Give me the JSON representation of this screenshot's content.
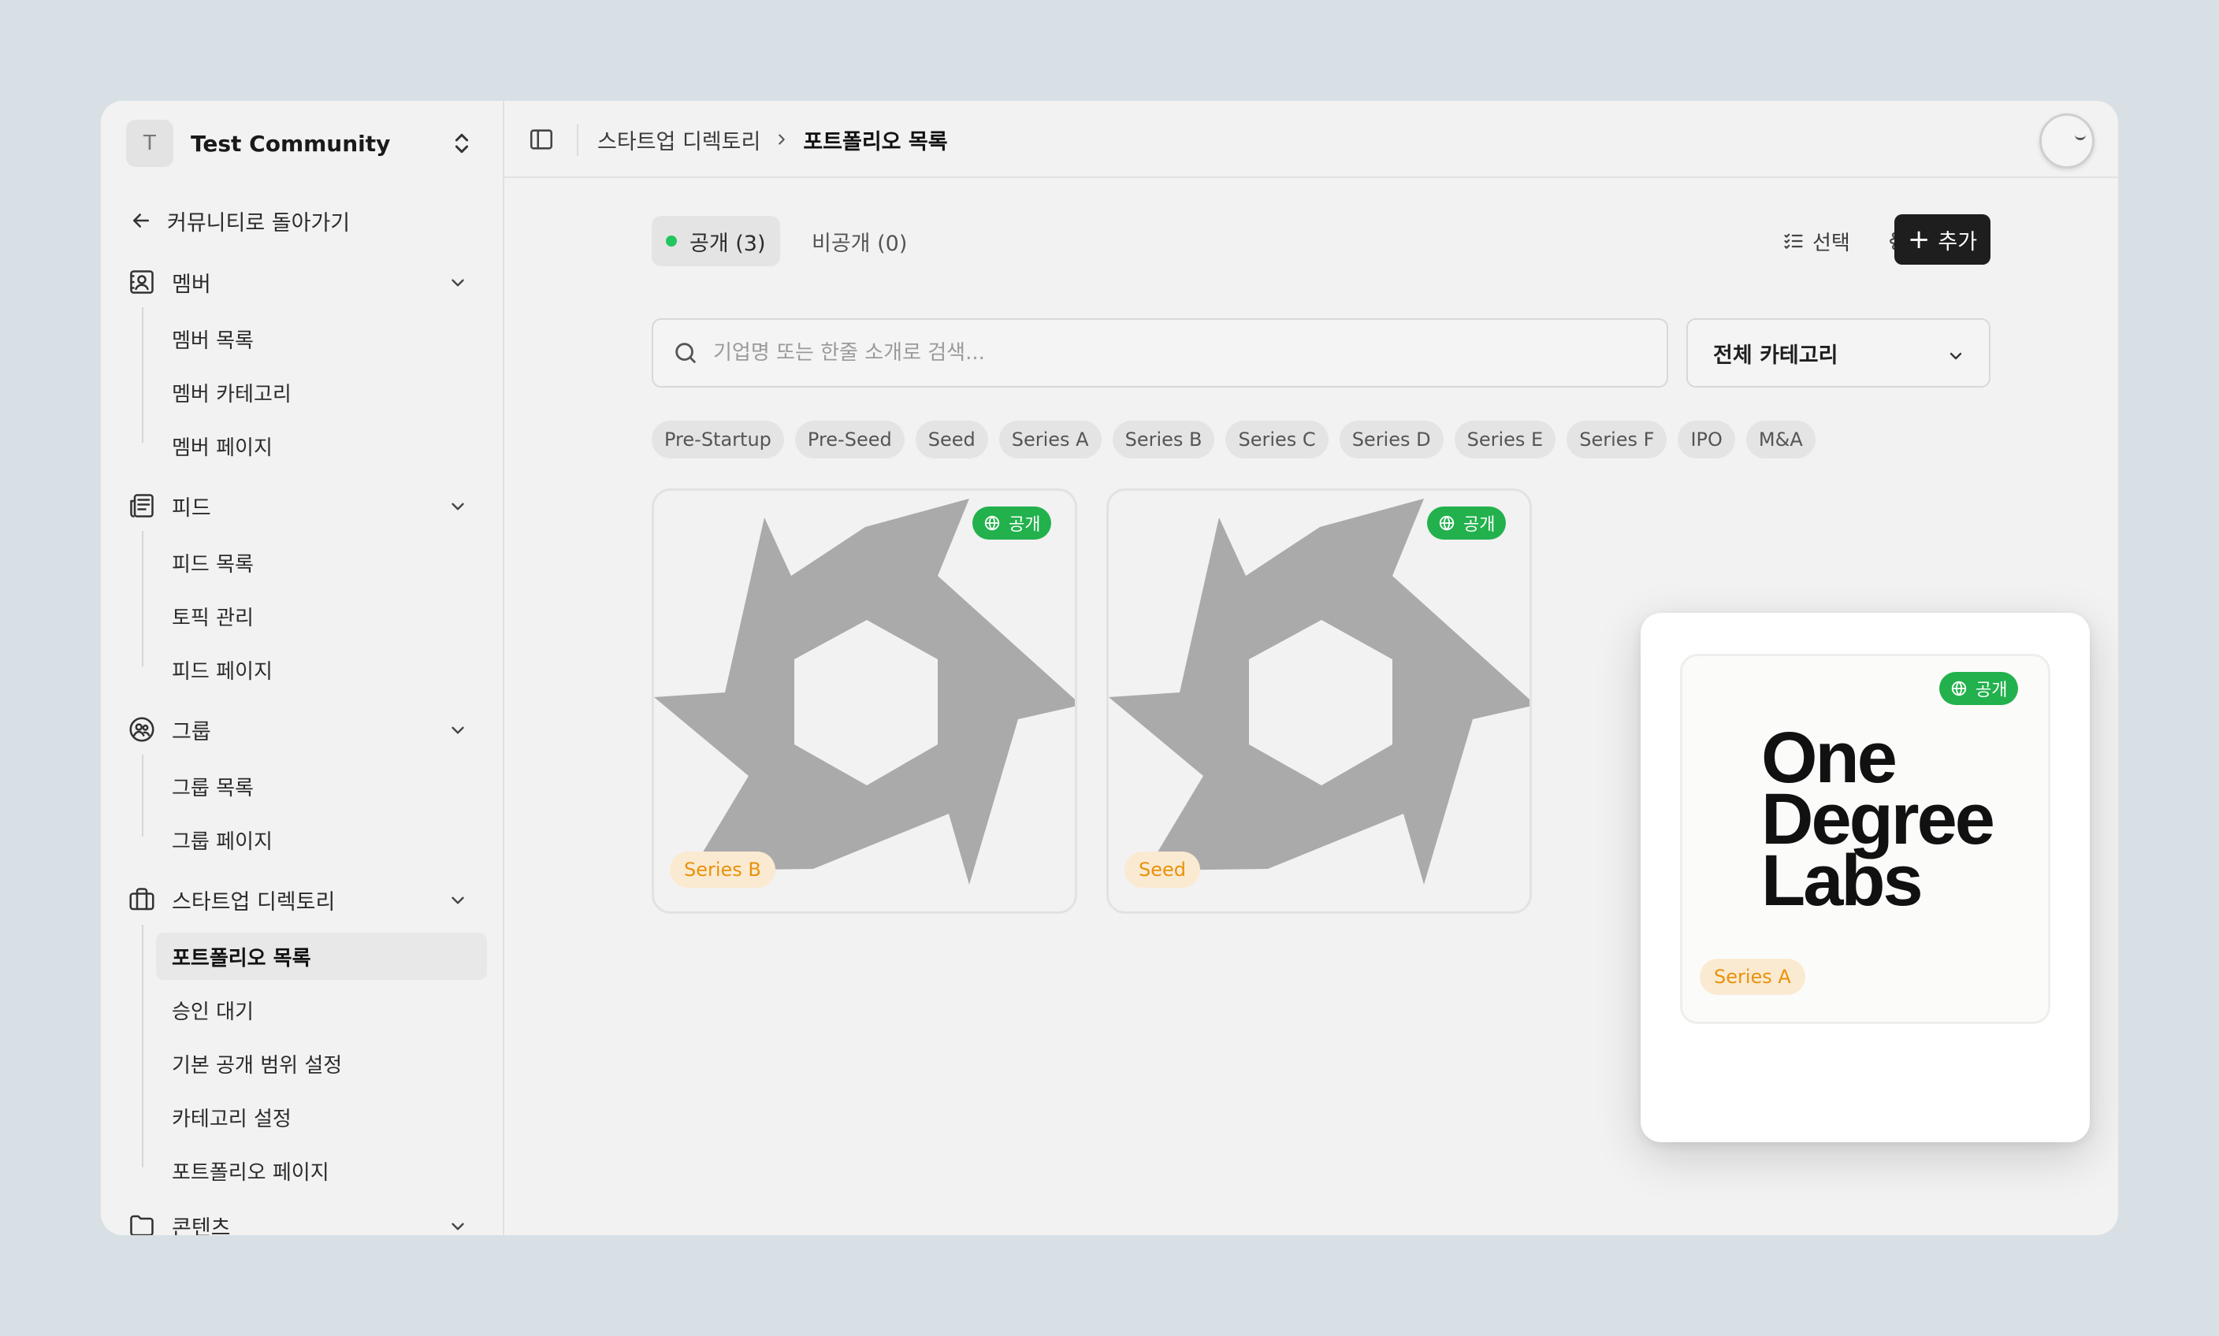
{
  "sidebar": {
    "community_initial": "T",
    "community_name": "Test Community",
    "back_label": "커뮤니티로 돌아가기",
    "sections": [
      {
        "label": "멤버",
        "items": [
          "멤버 목록",
          "멤버 카테고리",
          "멤버 페이지"
        ]
      },
      {
        "label": "피드",
        "items": [
          "피드 목록",
          "토픽 관리",
          "피드 페이지"
        ]
      },
      {
        "label": "그룹",
        "items": [
          "그룹 목록",
          "그룹 페이지"
        ]
      },
      {
        "label": "스타트업 디렉토리",
        "items": [
          "포트폴리오 목록",
          "승인 대기",
          "기본 공개 범위 설정",
          "카테고리 설정",
          "포트폴리오 페이지"
        ]
      },
      {
        "label": "콘텐츠",
        "items": []
      }
    ],
    "active_item": "포트폴리오 목록"
  },
  "topbar": {
    "breadcrumb_parent": "스타트업 디렉토리",
    "breadcrumb_current": "포트폴리오 목록"
  },
  "main": {
    "tab_public": "공개 (3)",
    "tab_private": "비공개 (0)",
    "select_label": "선택",
    "edit_label": "편집",
    "add_label": "추가",
    "search_placeholder": "기업명 또는 한줄 소개로 검색...",
    "category_select": "전체 카테고리",
    "stage_chips": [
      "Pre-Startup",
      "Pre-Seed",
      "Seed",
      "Series A",
      "Series B",
      "Series C",
      "Series D",
      "Series E",
      "Series F",
      "IPO",
      "M&A"
    ],
    "cards": [
      {
        "visibility": "공개",
        "stage": "Series B"
      },
      {
        "visibility": "공개",
        "stage": "Seed"
      },
      {
        "visibility": "공개",
        "stage": "Series A",
        "logo_text": [
          "One",
          "Degree",
          "Labs"
        ]
      }
    ]
  },
  "colors": {
    "public_green": "#22b14c",
    "stage_orange": "#e8920c",
    "add_button": "#1e1e1e"
  }
}
